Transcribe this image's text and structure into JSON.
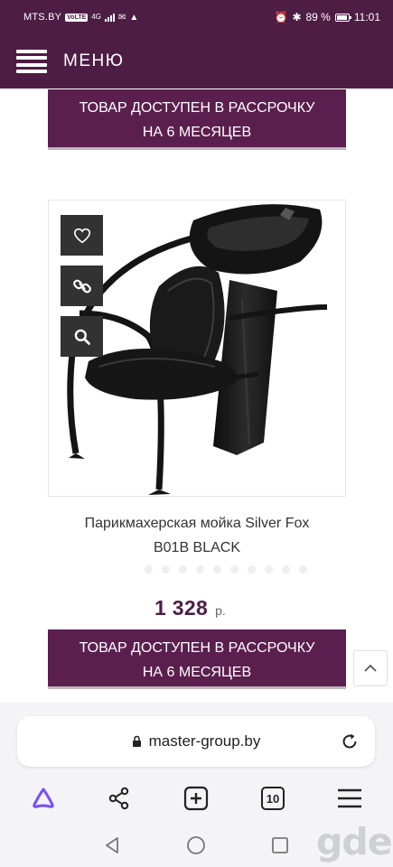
{
  "status_bar": {
    "carrier": "MTS.BY",
    "volte": "VoLTE",
    "network": "4G",
    "battery": "89 %",
    "time": "11:01"
  },
  "header": {
    "menu_label": "МЕНЮ"
  },
  "banner_top": {
    "line1": "ТОВАР ДОСТУПЕН В РАССРОЧКУ",
    "line2": "НА 6 МЕСЯЦЕВ"
  },
  "product": {
    "title_line1": "Парикмахерская мойка Silver Fox",
    "title_line2": "B01B BLACK",
    "price": "1 328",
    "currency": "р.",
    "actions": {
      "favorite_icon": "heart-icon",
      "link_icon": "link-icon",
      "zoom_icon": "search-icon"
    }
  },
  "banner_bottom": {
    "line1": "ТОВАР ДОСТУПЕН В РАССРОЧКУ",
    "line2": "НА 6 МЕСЯЦЕВ"
  },
  "browser": {
    "url": "master-group.by",
    "tabs_count": "10"
  },
  "watermark": "gde",
  "colors": {
    "brand": "#4d1d44",
    "banner": "#5b1f4f",
    "price": "#4d1d44",
    "alice": "#7a4dff"
  }
}
